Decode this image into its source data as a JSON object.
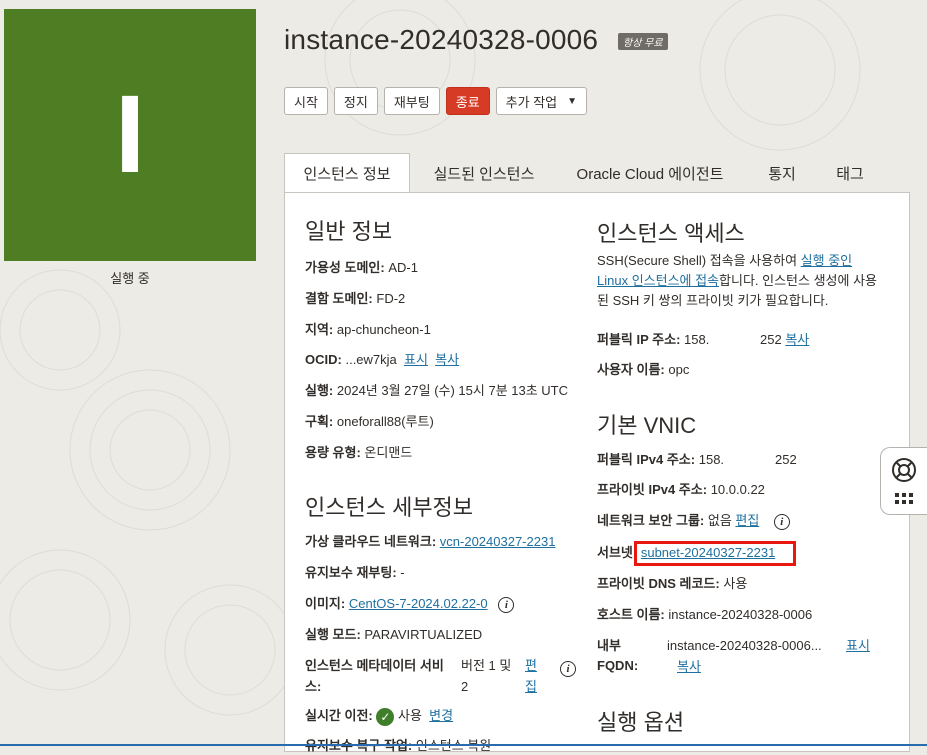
{
  "tile": {
    "letter": "I",
    "status": "실행 중",
    "color": "#4f7d24"
  },
  "header": {
    "title": "instance-20240328-0006",
    "badge": "항상 무료"
  },
  "actions": {
    "start": "시작",
    "stop": "정지",
    "reboot": "재부팅",
    "terminate": "종료",
    "more": "추가 작업"
  },
  "tabs": [
    "인스턴스 정보",
    "실드된 인스턴스",
    "Oracle Cloud 에이전트",
    "통지",
    "태그"
  ],
  "general": {
    "heading": "일반 정보",
    "ad_label": "가용성 도메인:",
    "ad_value": "AD-1",
    "fd_label": "결함 도메인:",
    "fd_value": "FD-2",
    "region_label": "지역:",
    "region_value": "ap-chuncheon-1",
    "ocid_label": "OCID:",
    "ocid_value": "...ew7kja",
    "ocid_show": "표시",
    "ocid_copy": "복사",
    "launched_label": "실행:",
    "launched_value": "2024년 3월 27일 (수) 15시 7분 13초 UTC",
    "compartment_label": "구획:",
    "compartment_value": "oneforall88(루트)",
    "capacity_label": "용량 유형:",
    "capacity_value": "온디맨드"
  },
  "details": {
    "heading": "인스턴스 세부정보",
    "vcn_label": "가상 클라우드 네트워크:",
    "vcn_value": "vcn-20240327-2231",
    "maint_label": "유지보수 재부팅:",
    "maint_value": "-",
    "image_label": "이미지:",
    "image_value": "CentOS-7-2024.02.22-0",
    "mode_label": "실행 모드:",
    "mode_value": "PARAVIRTUALIZED",
    "meta_label_1": "인스턴스 메타데이터 서비",
    "meta_label_2": "스:",
    "meta_value_1": "버전 1 및",
    "meta_value_2": "2",
    "meta_edit_1": "편",
    "meta_edit_2": "집",
    "live_label": "실시간 이전:",
    "live_value": "사용",
    "live_edit": "변경",
    "cut_label": "유지보수 복구 작업:",
    "cut_value": "인스턴스 복원"
  },
  "access": {
    "heading": "인스턴스 액세스",
    "desc_1a": "SSH(Secure Shell) 접속을 사용하여 ",
    "desc_1b": "실행 중인",
    "desc_2a": "Linux 인스턴스에 접속",
    "desc_2b": "합니다. 인스턴스 생성에 사용",
    "desc_3": "된 SSH 키 쌍의 프라이빗 키가 필요합니다.",
    "ip_label": "퍼블릭 IP 주소:",
    "ip_a": "158.",
    "ip_b": "252",
    "ip_copy": "복사",
    "user_label": "사용자 이름:",
    "user_value": "opc"
  },
  "vnic": {
    "heading": "기본 VNIC",
    "pub_label": "퍼블릭 IPv4 주소:",
    "pub_a": "158.",
    "pub_b": "252",
    "priv_label": "프라이빗 IPv4 주소:",
    "priv_value": "10.0.0.22",
    "nsg_label": "네트워크 보안 그룹:",
    "nsg_value": "없음",
    "nsg_edit": "편집",
    "subnet_label": "서브넷:",
    "subnet_value": "subnet-20240327-2231",
    "dns_label": "프라이빗 DNS 레코드:",
    "dns_value": "사용",
    "host_label": "호스트 이름:",
    "host_value": "instance-20240328-0006",
    "fqdn_label_1": "내부",
    "fqdn_label_2": "FQDN:",
    "fqdn_value": "instance-20240328-0006...",
    "fqdn_show": "표시",
    "fqdn_copy": "복사"
  },
  "launch_options": {
    "heading": "실행 옵션"
  }
}
